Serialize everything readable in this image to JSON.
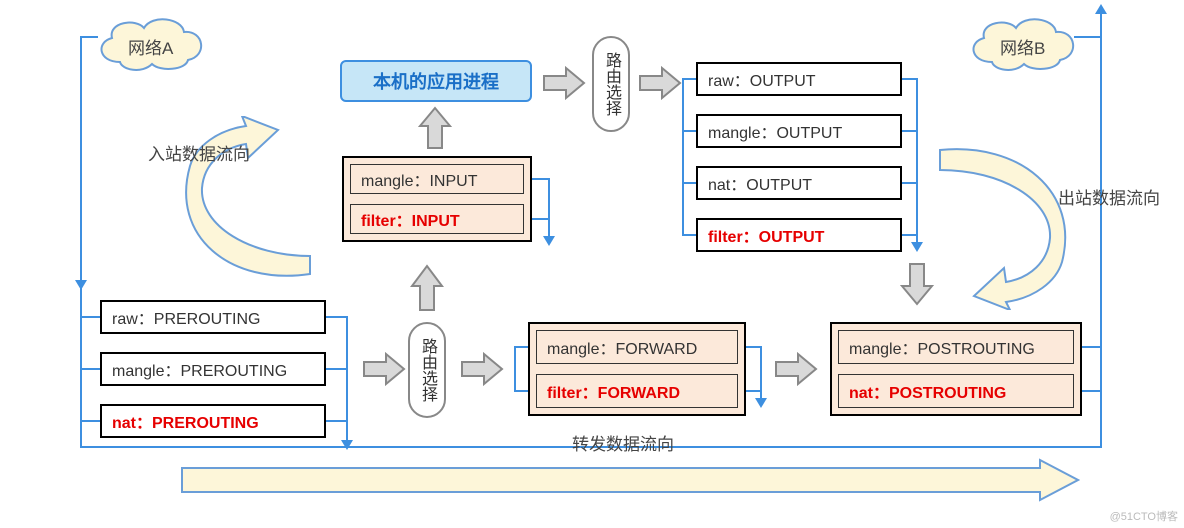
{
  "clouds": {
    "a": "网络A",
    "b": "网络B"
  },
  "app_process": "本机的应用进程",
  "route": {
    "label": "路由选择"
  },
  "labels": {
    "inbound": "入站数据流向",
    "outbound": "出站数据流向",
    "forward": "转发数据流向"
  },
  "prerouting": {
    "raw": "raw：PREROUTING",
    "mangle": "mangle：PREROUTING",
    "nat": "nat：PREROUTING"
  },
  "input": {
    "mangle": "mangle：INPUT",
    "filter": "filter：INPUT"
  },
  "output": {
    "raw": "raw：OUTPUT",
    "mangle": "mangle：OUTPUT",
    "nat": "nat：OUTPUT",
    "filter": "filter：OUTPUT"
  },
  "forward": {
    "mangle": "mangle：FORWARD",
    "filter": "filter：FORWARD"
  },
  "postrouting": {
    "mangle": "mangle：POSTROUTING",
    "nat": "nat：POSTROUTING"
  },
  "watermark": "@51CTO博客"
}
